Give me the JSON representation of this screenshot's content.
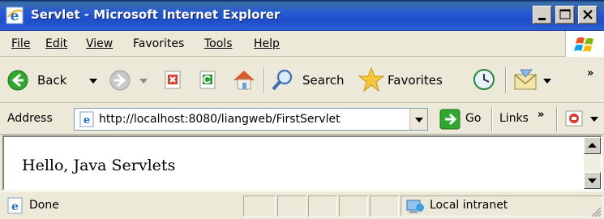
{
  "window": {
    "title": "Servlet - Microsoft Internet Explorer"
  },
  "menu": {
    "items": [
      "File",
      "Edit",
      "View",
      "Favorites",
      "Tools",
      "Help"
    ]
  },
  "toolbar": {
    "back_label": "Back",
    "search_label": "Search",
    "favorites_label": "Favorites",
    "overflow": "»"
  },
  "address": {
    "label": "Address",
    "url": "http://localhost:8080/liangweb/FirstServlet",
    "go_label": "Go",
    "links_label": "Links",
    "links_overflow": "»"
  },
  "content": {
    "text": "Hello, Java Servlets"
  },
  "status": {
    "text": "Done",
    "zone": "Local intranet"
  },
  "icons": [
    "ie-icon",
    "minimize-icon",
    "maximize-icon",
    "close-icon",
    "windows-logo-icon",
    "back-arrow-icon",
    "forward-arrow-icon",
    "stop-icon",
    "refresh-icon",
    "home-icon",
    "search-icon",
    "favorites-star-icon",
    "history-icon",
    "mail-icon",
    "page-icon",
    "go-arrow-icon",
    "zone-icon"
  ],
  "colors": {
    "titlebar": "#2458d8",
    "chrome": "#ece9d8",
    "address_border": "#7f9db9"
  }
}
